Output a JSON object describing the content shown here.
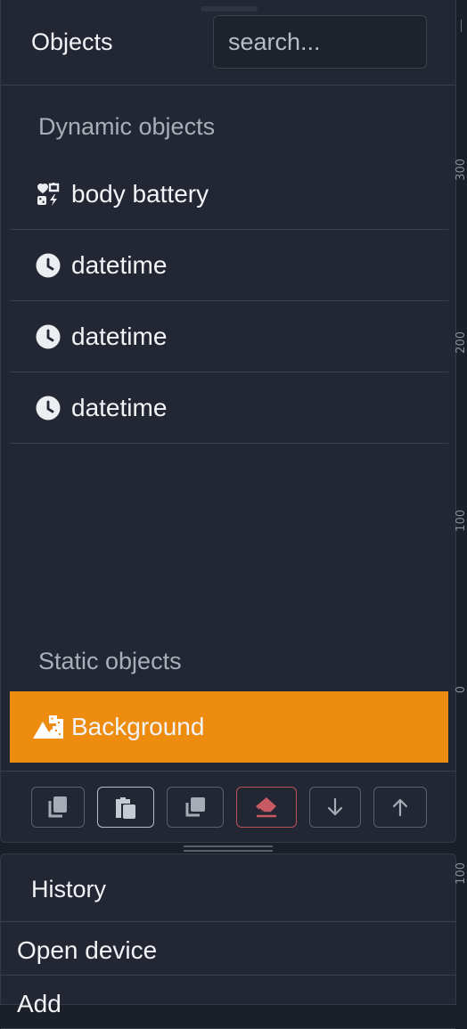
{
  "objects_panel": {
    "title": "Objects",
    "search_placeholder": "search...",
    "dynamic_section": {
      "label": "Dynamic objects",
      "items": [
        {
          "label": "body battery",
          "icon": "body-battery-icon"
        },
        {
          "label": "datetime",
          "icon": "clock-icon"
        },
        {
          "label": "datetime",
          "icon": "clock-icon"
        },
        {
          "label": "datetime",
          "icon": "clock-icon"
        }
      ]
    },
    "static_section": {
      "label": "Static objects",
      "items": [
        {
          "label": "Background",
          "icon": "background-image-icon",
          "selected": true
        }
      ]
    },
    "toolbar": [
      {
        "icon": "copy-icon",
        "name": "copy-button"
      },
      {
        "icon": "paste-icon",
        "name": "paste-button"
      },
      {
        "icon": "duplicate-icon",
        "name": "duplicate-button"
      },
      {
        "icon": "eraser-icon",
        "name": "delete-button"
      },
      {
        "icon": "arrow-down-icon",
        "name": "move-down-button"
      },
      {
        "icon": "arrow-up-icon",
        "name": "move-up-button"
      }
    ]
  },
  "history_panel": {
    "title": "History",
    "items": [
      "Open device",
      "Add"
    ]
  },
  "ruler": {
    "labels": [
      "300",
      "200",
      "100",
      "0",
      "100"
    ]
  },
  "colors": {
    "panel_bg": "#232733",
    "selected_accent": "#ee8c0f",
    "danger": "#b5525b",
    "border": "#3a404c"
  }
}
